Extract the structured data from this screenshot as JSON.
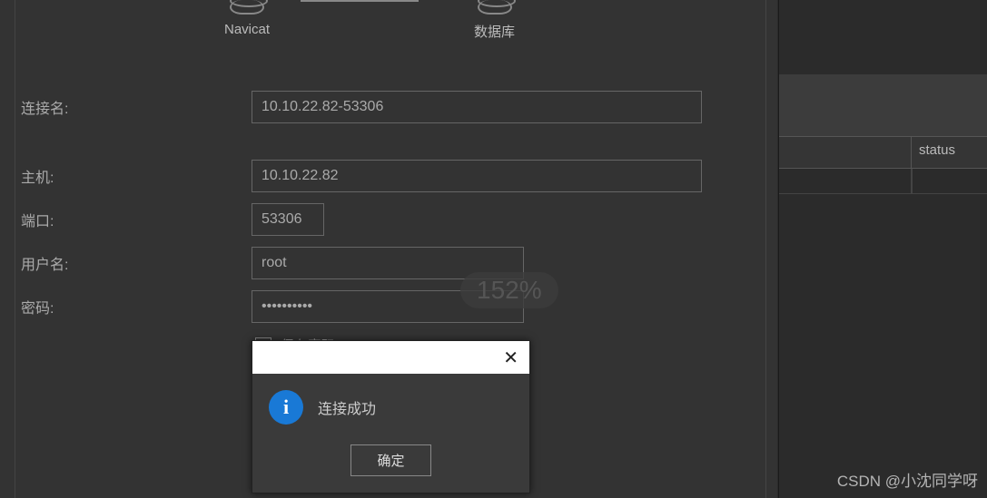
{
  "products": {
    "navicat_label": "Navicat",
    "db_label": "数据库"
  },
  "form": {
    "connection_name_label": "连接名:",
    "connection_name_value": "10.10.22.82-53306",
    "host_label": "主机:",
    "host_value": "10.10.22.82",
    "port_label": "端口:",
    "port_value": "53306",
    "username_label": "用户名:",
    "username_value": "root",
    "password_label": "密码:",
    "password_value": "••••••••••",
    "save_password_label": "保存密码",
    "save_password_checked": "✓"
  },
  "zoom": "152%",
  "modal": {
    "message": "连接成功",
    "ok_label": "确定",
    "info_glyph": "i"
  },
  "right": {
    "status_header": "status"
  },
  "watermark": "CSDN @小沈同学呀"
}
